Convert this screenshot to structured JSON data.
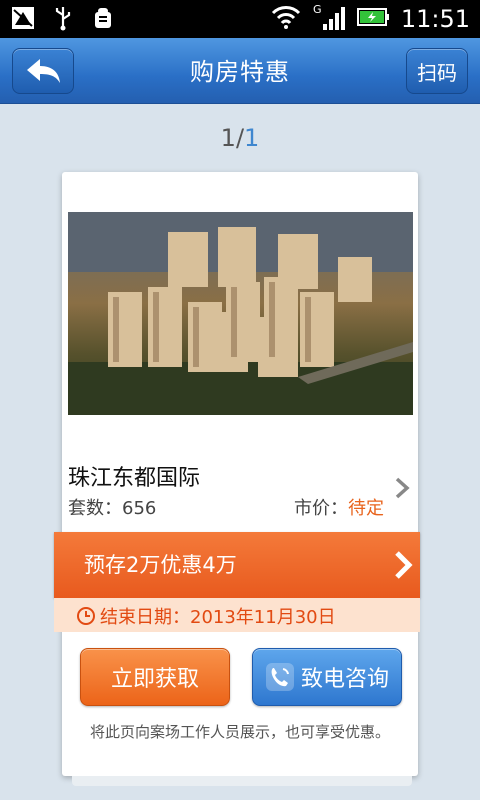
{
  "statusbar": {
    "time": "11:51",
    "icons": [
      "app-icon",
      "usb-icon",
      "android-debug-icon",
      "wifi-icon",
      "gprs-icon",
      "signal-icon",
      "battery-charging-icon"
    ]
  },
  "header": {
    "title": "购房特惠",
    "scan_label": "扫码",
    "back_icon": "back-arrow-icon"
  },
  "pager": {
    "current": "1",
    "sep": "/",
    "total": "1"
  },
  "property": {
    "name": "珠江东都国际",
    "count_label": "套数：656",
    "price_label": "市价：",
    "price_value": "待定"
  },
  "promo": {
    "text": "预存2万优惠4万",
    "end_date": "结束日期：2013年11月30日"
  },
  "actions": {
    "get_label": "立即获取",
    "call_label": "致电咨询"
  },
  "note": "将此页向案场工作人员展示，也可享受优惠。",
  "colors": {
    "accent_blue": "#2a6fc6",
    "accent_orange": "#e85a1e",
    "price": "#e8641d"
  }
}
